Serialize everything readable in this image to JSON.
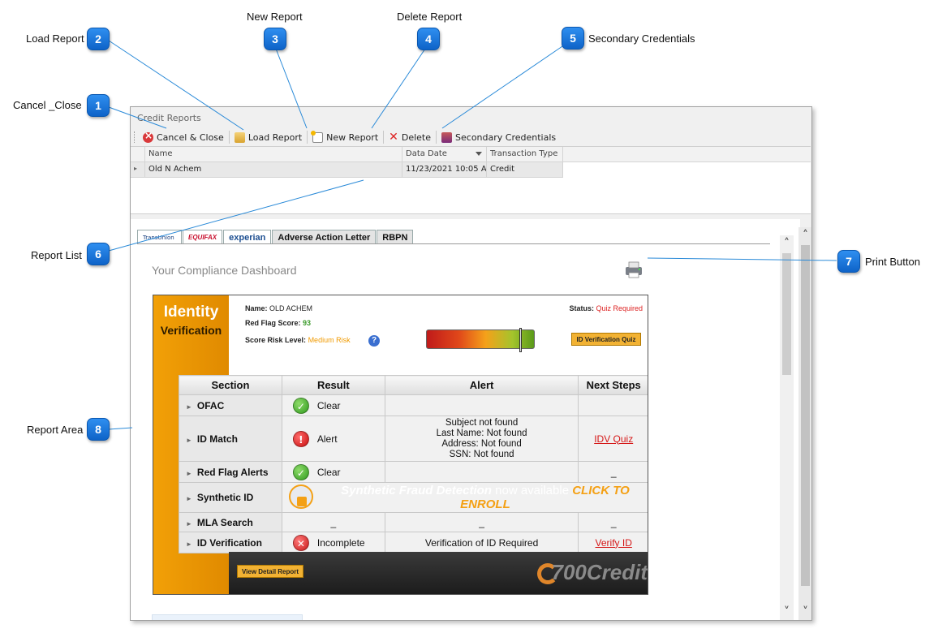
{
  "callouts": [
    {
      "num": "1",
      "label": "Cancel _Close"
    },
    {
      "num": "2",
      "label": "Load Report"
    },
    {
      "num": "3",
      "label": "New Report"
    },
    {
      "num": "4",
      "label": "Delete Report"
    },
    {
      "num": "5",
      "label": "Secondary Credentials"
    },
    {
      "num": "6",
      "label": "Report List"
    },
    {
      "num": "7",
      "label": "Print Button"
    },
    {
      "num": "8",
      "label": "Report Area"
    }
  ],
  "window": {
    "title": "Credit Reports"
  },
  "toolbar": {
    "cancel_label": "Cancel & Close",
    "load_label": "Load Report",
    "new_label": "New Report",
    "delete_label": "Delete",
    "cred_label": "Secondary Credentials"
  },
  "grid": {
    "columns": [
      "Name",
      "Data Date",
      "Transaction Type"
    ],
    "rows": [
      {
        "name": "Old N Achem",
        "date": "11/23/2021 10:05 AM",
        "type": "Credit"
      }
    ]
  },
  "tabs": [
    "TransUnion",
    "EQUIFAX",
    "experian",
    "Adverse Action Letter",
    "RBPN"
  ],
  "dashboard": {
    "title": "Your Compliance Dashboard"
  },
  "idv": {
    "title": "Identity",
    "subtitle": "Verification",
    "name_label": "Name:",
    "name_value": "OLD ACHEM",
    "score_label": "Red Flag Score:",
    "score_value": "93",
    "risk_label": "Score Risk Level:",
    "risk_value": "Medium Risk",
    "status_label": "Status:",
    "status_value": "Quiz Required",
    "quiz_button": "ID Verification Quiz",
    "gauge_level": 0.86,
    "headers": [
      "Section",
      "Result",
      "Alert",
      "Next Steps"
    ],
    "rows": [
      {
        "section": "OFAC",
        "result": "Clear",
        "alert": "",
        "next": ""
      },
      {
        "section": "ID Match",
        "result": "Alert",
        "alert": [
          "Subject not found",
          "Last Name: Not found",
          "Address: Not found",
          "SSN: Not found"
        ],
        "next": "IDV Quiz"
      },
      {
        "section": "Red Flag Alerts",
        "result": "Clear",
        "alert": "",
        "next": "_"
      },
      {
        "section": "Synthetic ID",
        "banner_main": "Synthetic Fraud Detection",
        "banner_mid": " now available ",
        "banner_cta": "CLICK TO ENROLL"
      },
      {
        "section": "MLA Search",
        "result": "_",
        "alert": "_",
        "next": "_"
      },
      {
        "section": "ID Verification",
        "result": "Incomplete",
        "alert": "Verification of ID Required",
        "next": "Verify ID"
      }
    ],
    "detail_button": "View Detail Report",
    "brand": "700Credit"
  },
  "colors": {
    "accent": "#0e63c8",
    "orange": "#f2a007",
    "alert_red": "#d51616",
    "clear_green": "#3a9a2a"
  },
  "icons": {
    "print": "printer-icon",
    "help": "help-icon",
    "scroll_up": "chevron-up-icon",
    "scroll_down": "chevron-down-icon"
  }
}
